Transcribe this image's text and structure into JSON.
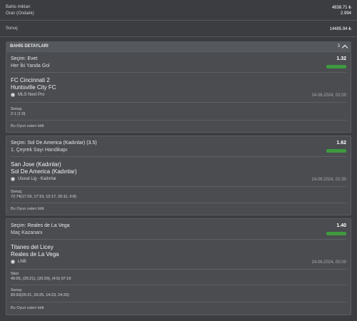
{
  "summary": {
    "stake_label": "Bahis miktarı",
    "stake_value": "4838.71 ₺",
    "odds_label": "Oran (Ondalık)",
    "odds_value": "2.994",
    "result_label": "Sonuç",
    "result_value": "14485.94 ₺"
  },
  "details": {
    "title": "BAHİS DETAYLARI",
    "count": "3"
  },
  "bets": [
    {
      "selection": "Seçim: Evet",
      "odds": "1.32",
      "market": "Her İki Yanda Gol",
      "home": "FC Cincinnati 2",
      "away": "Huntsville City FC",
      "league": "MLS Next Pro",
      "datetime": "24.06.2024, 02:00",
      "score_label": "Sonuç",
      "score_value": "2:1 (1:0)",
      "status": "Bu Oyun zaten bitti",
      "badge_color": "#3f9a3f"
    },
    {
      "selection": "Seçim: Sol De America (Kadınlar) (3.5)",
      "odds": "1.62",
      "market": "1. Çeyrek Sayı Handikapı",
      "home": "San Jose (Kadınlar)",
      "away": "Sol De America (Kadınlar)",
      "league": "Ulusal Lig - Kadınlar",
      "datetime": "24.06.2024, 01:30",
      "score_label": "Sonuç",
      "score_value": "72:74(17:19, 17:19, 12:17, 20:11, 6:8)",
      "status": "Bu Oyun zaten bitti",
      "badge_color": "#3f9a3f"
    },
    {
      "selection": "Seçim: Reales de La Vega",
      "odds": "1.40",
      "market": "Maç Kazananı",
      "home": "Titanes del Licey",
      "away": "Reales de La Vega",
      "league": "LNB",
      "datetime": "24.06.2024, 00:00",
      "skor_label": "Skor",
      "skor_value": "49:55, (25:21), (20:29), (4:5) 07:19",
      "score_label": "Sonuç",
      "score_value": "83:93(25:21, 20:25, 14:23, 24:20)",
      "status": "Bu Oyun zaten bitti",
      "badge_color": "#3f9a3f"
    }
  ]
}
